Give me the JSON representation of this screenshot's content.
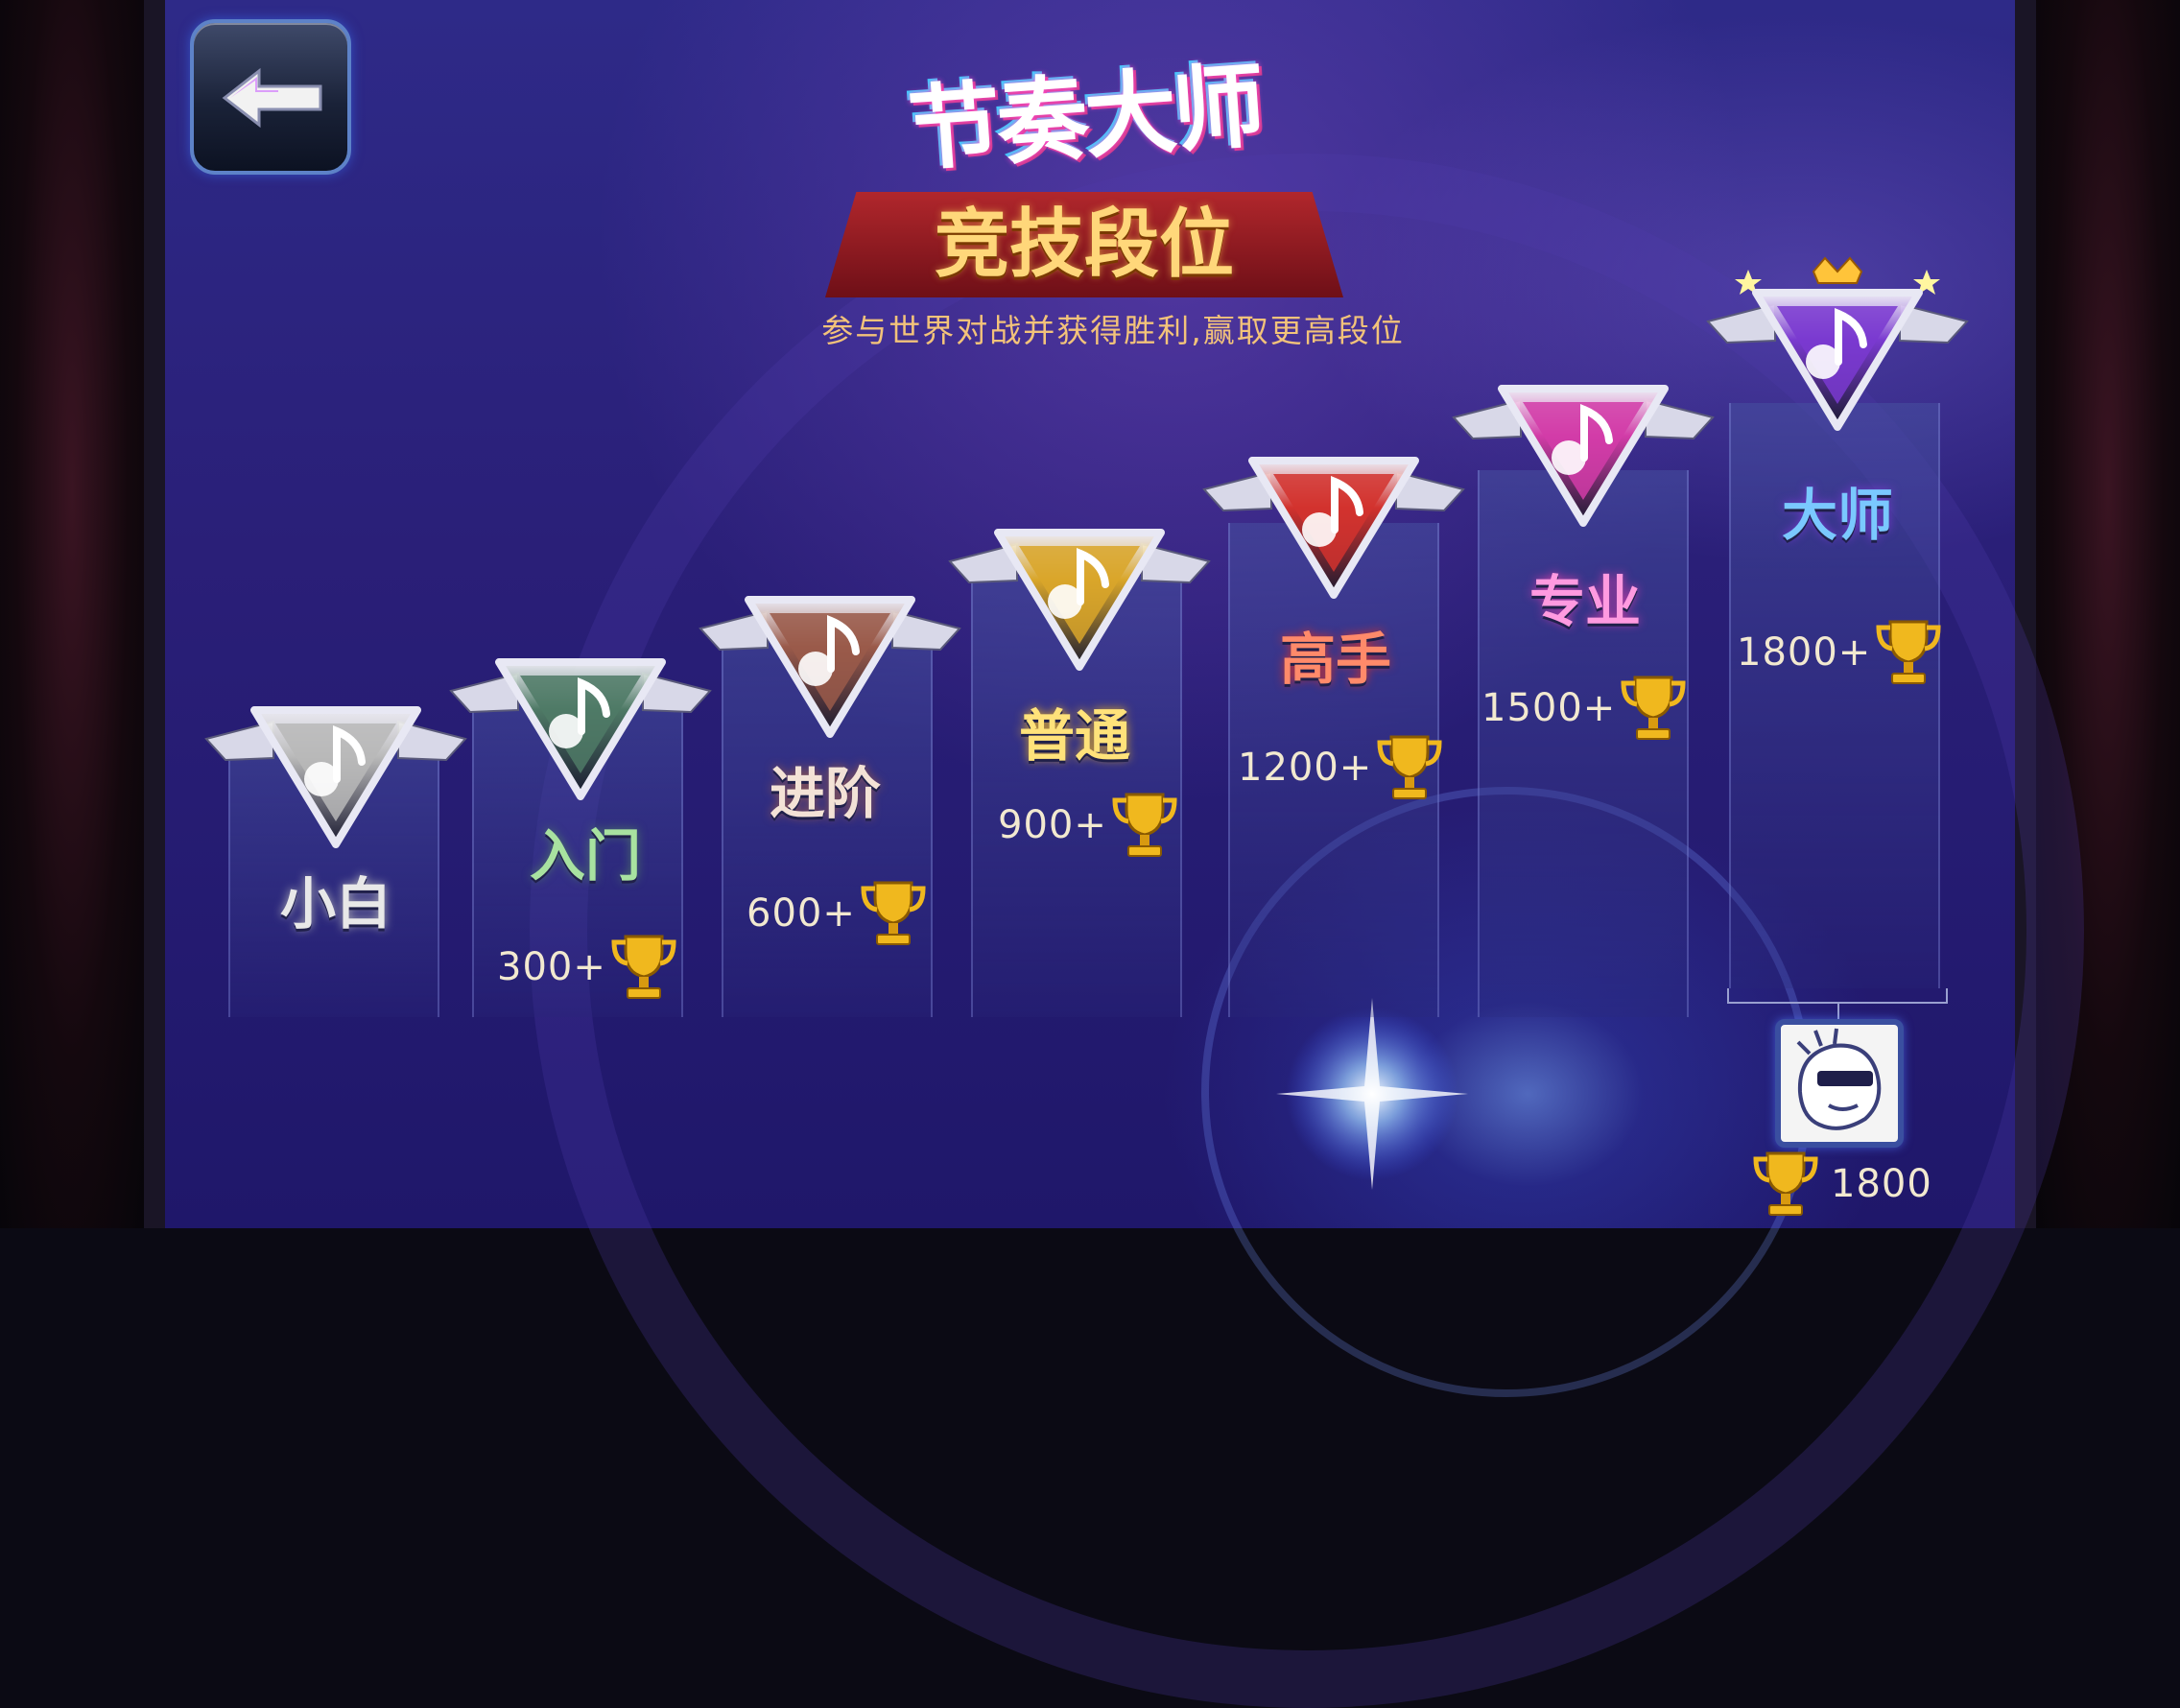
{
  "header": {
    "logo_title": "节奏大师",
    "logo_subtitle": "竞技段位",
    "caption": "参与世界对战并获得胜利,赢取更高段位"
  },
  "back_button": {
    "icon": "arrow-left-icon"
  },
  "ranks": [
    {
      "name": "小白",
      "score": "",
      "color": "#b9b9b9",
      "text_color": "#e8e8e8"
    },
    {
      "name": "入门",
      "score": "300+",
      "color": "#4f7a66",
      "text_color": "#a8e2a0"
    },
    {
      "name": "进阶",
      "score": "600+",
      "color": "#9a5a4a",
      "text_color": "#f3e2d6"
    },
    {
      "name": "普通",
      "score": "900+",
      "color": "#d9a62a",
      "text_color": "#ffe27a"
    },
    {
      "name": "高手",
      "score": "1200+",
      "color": "#d2322e",
      "text_color": "#ff8a6a"
    },
    {
      "name": "专业",
      "score": "1500+",
      "color": "#d23ca8",
      "text_color": "#ff9ae0"
    },
    {
      "name": "大师",
      "score": "1800+",
      "color": "#7a3ad0",
      "text_color": "#7ac8ff"
    }
  ],
  "player": {
    "avatar_icon": "sunglasses-avatar-icon",
    "trophy_icon": "trophy-icon",
    "score": "1800"
  }
}
